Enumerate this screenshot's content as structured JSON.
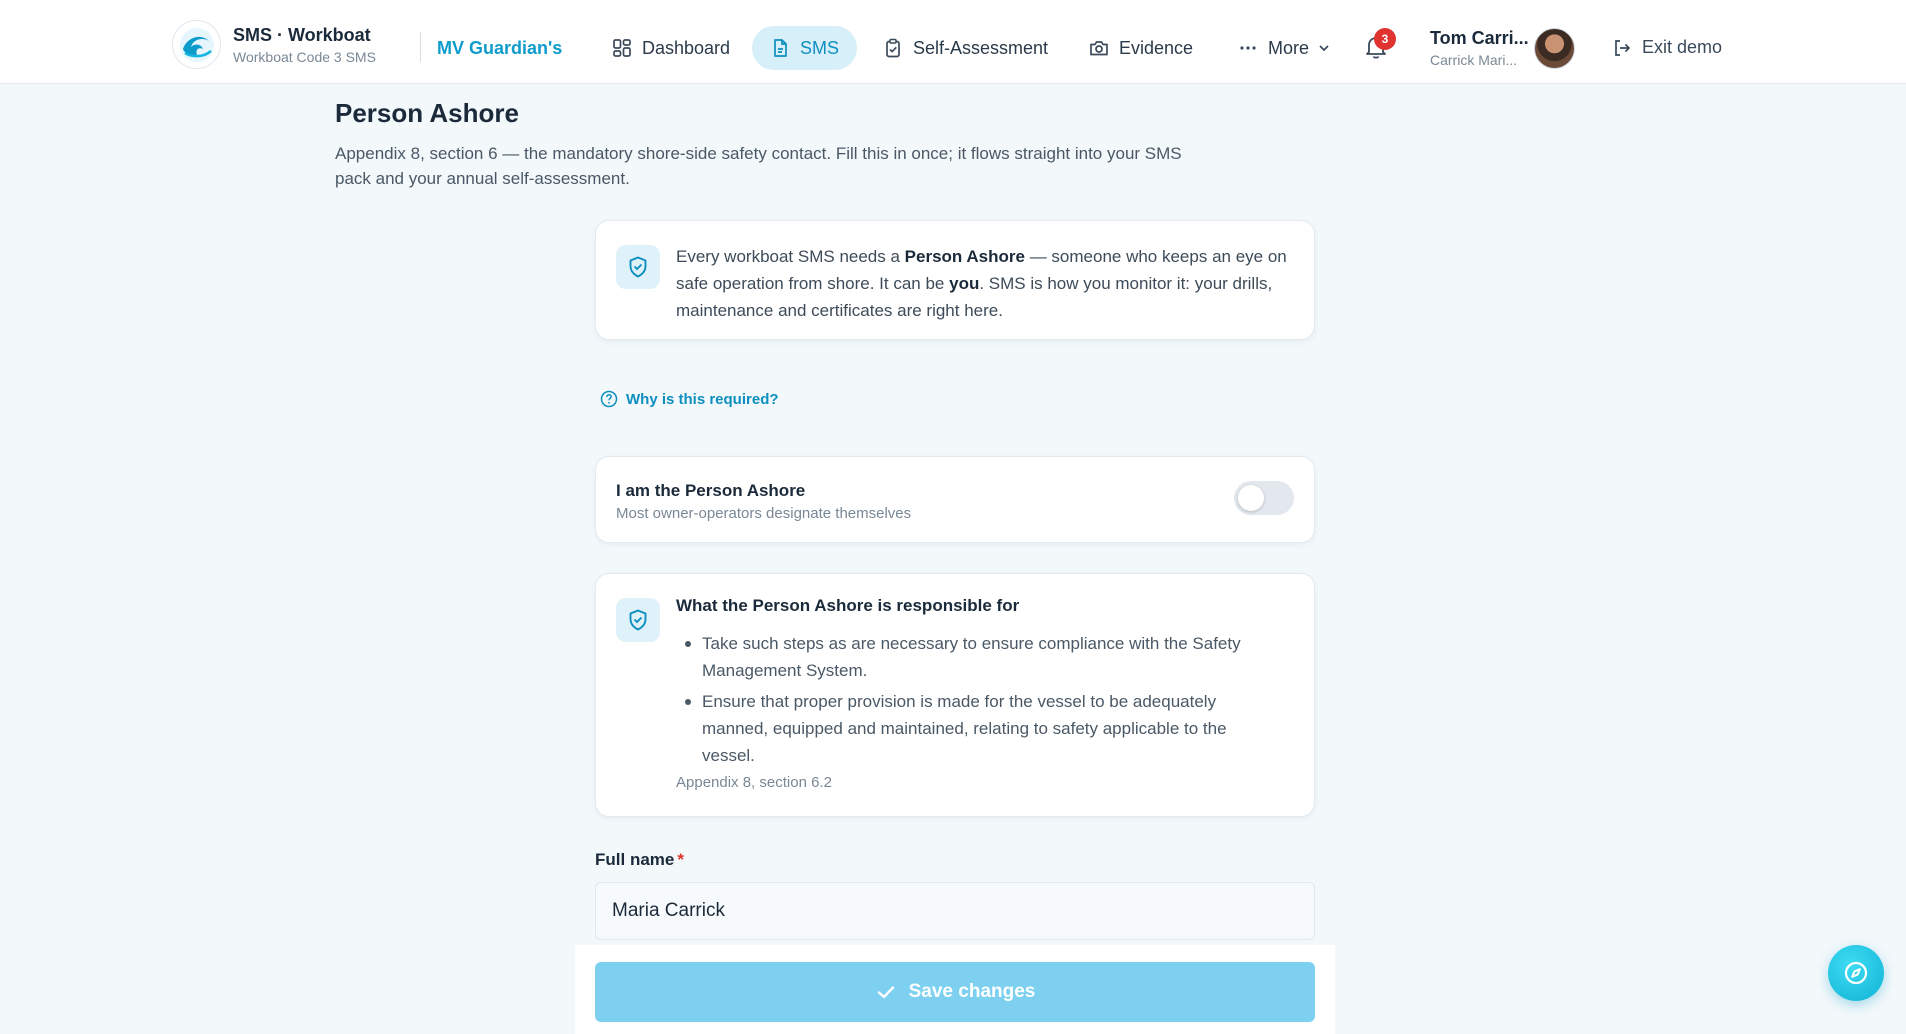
{
  "brand": {
    "title": "SMS · Workboat",
    "subtitle": "Workboat Code 3 SMS",
    "vessel": "MV Guardian's"
  },
  "nav": {
    "dashboard": "Dashboard",
    "sms": "SMS",
    "self_assessment": "Self-Assessment",
    "evidence": "Evidence",
    "more": "More"
  },
  "notifications": {
    "count": "3"
  },
  "user": {
    "name": "Tom Carri...",
    "org": "Carrick Mari..."
  },
  "exit_label": "Exit demo",
  "page": {
    "title": "Person Ashore",
    "description": "Appendix 8, section 6 — the mandatory shore-side safety contact. Fill this in once; it flows straight into your SMS pack and your annual self-assessment."
  },
  "info": {
    "p1": "Every workboat SMS needs a ",
    "b1": "Person Ashore",
    "p2": " — someone who keeps an eye on safe operation from shore. It can be ",
    "b2": "you",
    "p3": ". SMS is how you monitor it: your drills, maintenance and certificates are right here."
  },
  "why_link": "Why is this required?",
  "toggle": {
    "title": "I am the Person Ashore",
    "subtitle": "Most owner-operators designate themselves",
    "on": false
  },
  "responsibilities": {
    "title": "What the Person Ashore is responsible for",
    "items": [
      "Take such steps as are necessary to ensure compliance with the Safety Management System.",
      "Ensure that proper provision is made for the vessel to be adequately manned, equipped and maintained, relating to safety applicable to the vessel."
    ],
    "reference": "Appendix 8, section 6.2"
  },
  "form": {
    "full_name_label": "Full name",
    "required_mark": "*",
    "full_name_value": "Maria Carrick"
  },
  "save_label": "Save changes",
  "colors": {
    "accent": "#0e8fc0",
    "save": "#7dd0ef",
    "badge": "#e0322f"
  }
}
